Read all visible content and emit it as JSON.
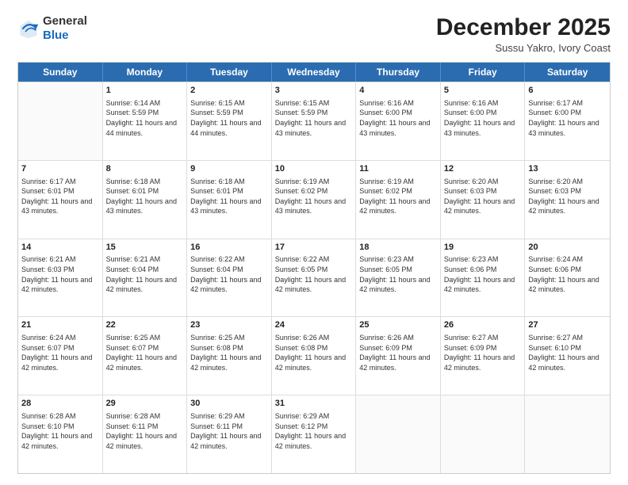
{
  "logo": {
    "general": "General",
    "blue": "Blue"
  },
  "title": "December 2025",
  "subtitle": "Sussu Yakro, Ivory Coast",
  "days_of_week": [
    "Sunday",
    "Monday",
    "Tuesday",
    "Wednesday",
    "Thursday",
    "Friday",
    "Saturday"
  ],
  "rows": [
    [
      {
        "day": "",
        "sunrise": "",
        "sunset": "",
        "daylight": ""
      },
      {
        "day": "1",
        "sunrise": "Sunrise: 6:14 AM",
        "sunset": "Sunset: 5:59 PM",
        "daylight": "Daylight: 11 hours and 44 minutes."
      },
      {
        "day": "2",
        "sunrise": "Sunrise: 6:15 AM",
        "sunset": "Sunset: 5:59 PM",
        "daylight": "Daylight: 11 hours and 44 minutes."
      },
      {
        "day": "3",
        "sunrise": "Sunrise: 6:15 AM",
        "sunset": "Sunset: 5:59 PM",
        "daylight": "Daylight: 11 hours and 43 minutes."
      },
      {
        "day": "4",
        "sunrise": "Sunrise: 6:16 AM",
        "sunset": "Sunset: 6:00 PM",
        "daylight": "Daylight: 11 hours and 43 minutes."
      },
      {
        "day": "5",
        "sunrise": "Sunrise: 6:16 AM",
        "sunset": "Sunset: 6:00 PM",
        "daylight": "Daylight: 11 hours and 43 minutes."
      },
      {
        "day": "6",
        "sunrise": "Sunrise: 6:17 AM",
        "sunset": "Sunset: 6:00 PM",
        "daylight": "Daylight: 11 hours and 43 minutes."
      }
    ],
    [
      {
        "day": "7",
        "sunrise": "Sunrise: 6:17 AM",
        "sunset": "Sunset: 6:01 PM",
        "daylight": "Daylight: 11 hours and 43 minutes."
      },
      {
        "day": "8",
        "sunrise": "Sunrise: 6:18 AM",
        "sunset": "Sunset: 6:01 PM",
        "daylight": "Daylight: 11 hours and 43 minutes."
      },
      {
        "day": "9",
        "sunrise": "Sunrise: 6:18 AM",
        "sunset": "Sunset: 6:01 PM",
        "daylight": "Daylight: 11 hours and 43 minutes."
      },
      {
        "day": "10",
        "sunrise": "Sunrise: 6:19 AM",
        "sunset": "Sunset: 6:02 PM",
        "daylight": "Daylight: 11 hours and 43 minutes."
      },
      {
        "day": "11",
        "sunrise": "Sunrise: 6:19 AM",
        "sunset": "Sunset: 6:02 PM",
        "daylight": "Daylight: 11 hours and 42 minutes."
      },
      {
        "day": "12",
        "sunrise": "Sunrise: 6:20 AM",
        "sunset": "Sunset: 6:03 PM",
        "daylight": "Daylight: 11 hours and 42 minutes."
      },
      {
        "day": "13",
        "sunrise": "Sunrise: 6:20 AM",
        "sunset": "Sunset: 6:03 PM",
        "daylight": "Daylight: 11 hours and 42 minutes."
      }
    ],
    [
      {
        "day": "14",
        "sunrise": "Sunrise: 6:21 AM",
        "sunset": "Sunset: 6:03 PM",
        "daylight": "Daylight: 11 hours and 42 minutes."
      },
      {
        "day": "15",
        "sunrise": "Sunrise: 6:21 AM",
        "sunset": "Sunset: 6:04 PM",
        "daylight": "Daylight: 11 hours and 42 minutes."
      },
      {
        "day": "16",
        "sunrise": "Sunrise: 6:22 AM",
        "sunset": "Sunset: 6:04 PM",
        "daylight": "Daylight: 11 hours and 42 minutes."
      },
      {
        "day": "17",
        "sunrise": "Sunrise: 6:22 AM",
        "sunset": "Sunset: 6:05 PM",
        "daylight": "Daylight: 11 hours and 42 minutes."
      },
      {
        "day": "18",
        "sunrise": "Sunrise: 6:23 AM",
        "sunset": "Sunset: 6:05 PM",
        "daylight": "Daylight: 11 hours and 42 minutes."
      },
      {
        "day": "19",
        "sunrise": "Sunrise: 6:23 AM",
        "sunset": "Sunset: 6:06 PM",
        "daylight": "Daylight: 11 hours and 42 minutes."
      },
      {
        "day": "20",
        "sunrise": "Sunrise: 6:24 AM",
        "sunset": "Sunset: 6:06 PM",
        "daylight": "Daylight: 11 hours and 42 minutes."
      }
    ],
    [
      {
        "day": "21",
        "sunrise": "Sunrise: 6:24 AM",
        "sunset": "Sunset: 6:07 PM",
        "daylight": "Daylight: 11 hours and 42 minutes."
      },
      {
        "day": "22",
        "sunrise": "Sunrise: 6:25 AM",
        "sunset": "Sunset: 6:07 PM",
        "daylight": "Daylight: 11 hours and 42 minutes."
      },
      {
        "day": "23",
        "sunrise": "Sunrise: 6:25 AM",
        "sunset": "Sunset: 6:08 PM",
        "daylight": "Daylight: 11 hours and 42 minutes."
      },
      {
        "day": "24",
        "sunrise": "Sunrise: 6:26 AM",
        "sunset": "Sunset: 6:08 PM",
        "daylight": "Daylight: 11 hours and 42 minutes."
      },
      {
        "day": "25",
        "sunrise": "Sunrise: 6:26 AM",
        "sunset": "Sunset: 6:09 PM",
        "daylight": "Daylight: 11 hours and 42 minutes."
      },
      {
        "day": "26",
        "sunrise": "Sunrise: 6:27 AM",
        "sunset": "Sunset: 6:09 PM",
        "daylight": "Daylight: 11 hours and 42 minutes."
      },
      {
        "day": "27",
        "sunrise": "Sunrise: 6:27 AM",
        "sunset": "Sunset: 6:10 PM",
        "daylight": "Daylight: 11 hours and 42 minutes."
      }
    ],
    [
      {
        "day": "28",
        "sunrise": "Sunrise: 6:28 AM",
        "sunset": "Sunset: 6:10 PM",
        "daylight": "Daylight: 11 hours and 42 minutes."
      },
      {
        "day": "29",
        "sunrise": "Sunrise: 6:28 AM",
        "sunset": "Sunset: 6:11 PM",
        "daylight": "Daylight: 11 hours and 42 minutes."
      },
      {
        "day": "30",
        "sunrise": "Sunrise: 6:29 AM",
        "sunset": "Sunset: 6:11 PM",
        "daylight": "Daylight: 11 hours and 42 minutes."
      },
      {
        "day": "31",
        "sunrise": "Sunrise: 6:29 AM",
        "sunset": "Sunset: 6:12 PM",
        "daylight": "Daylight: 11 hours and 42 minutes."
      },
      {
        "day": "",
        "sunrise": "",
        "sunset": "",
        "daylight": ""
      },
      {
        "day": "",
        "sunrise": "",
        "sunset": "",
        "daylight": ""
      },
      {
        "day": "",
        "sunrise": "",
        "sunset": "",
        "daylight": ""
      }
    ]
  ]
}
